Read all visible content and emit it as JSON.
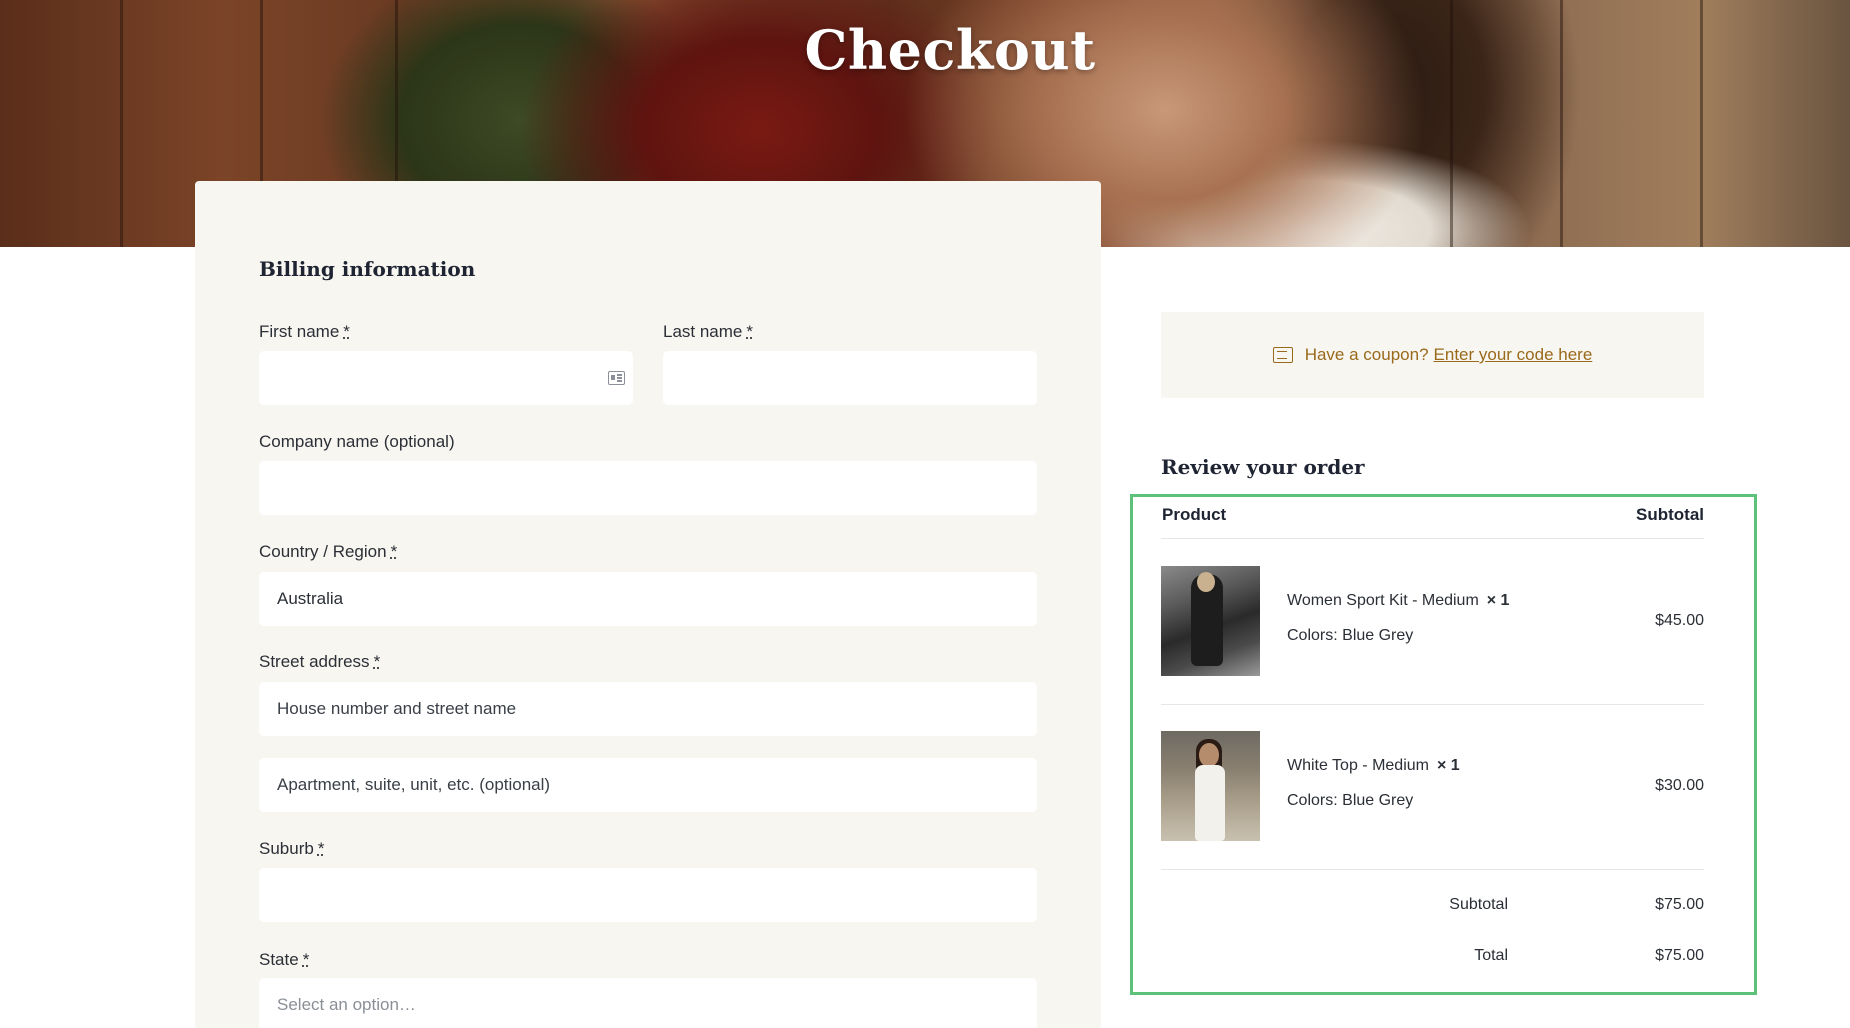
{
  "page": {
    "title": "Checkout"
  },
  "billing": {
    "title": "Billing information",
    "required_mark": "*",
    "first_name": {
      "label": "First name",
      "value": ""
    },
    "last_name": {
      "label": "Last name",
      "value": ""
    },
    "company": {
      "label": "Company name (optional)",
      "value": ""
    },
    "country": {
      "label": "Country / Region",
      "value": "Australia"
    },
    "street": {
      "label": "Street address",
      "placeholder_1": "House number and street name",
      "placeholder_2": "Apartment, suite, unit, etc. (optional)"
    },
    "suburb": {
      "label": "Suburb",
      "value": ""
    },
    "state": {
      "label": "State",
      "placeholder": "Select an option…"
    }
  },
  "coupon": {
    "text": "Have a coupon?",
    "link": "Enter your code here",
    "icon": "ticket-icon"
  },
  "review": {
    "title": "Review your order",
    "columns": {
      "product": "Product",
      "subtotal": "Subtotal"
    },
    "items": [
      {
        "name": "Women Sport Kit - Medium",
        "qty": "× 1",
        "meta_label": "Colors:",
        "meta_value": "Blue Grey",
        "price": "$45.00"
      },
      {
        "name": "White Top - Medium",
        "qty": "× 1",
        "meta_label": "Colors:",
        "meta_value": "Blue Grey",
        "price": "$30.00"
      }
    ],
    "subtotal_label": "Subtotal",
    "subtotal_value": "$75.00",
    "total_label": "Total",
    "total_value": "$75.00"
  },
  "colors": {
    "accent": "#9a6a1c",
    "highlight": "#5cc27a",
    "card_bg": "#f8f6f1"
  }
}
